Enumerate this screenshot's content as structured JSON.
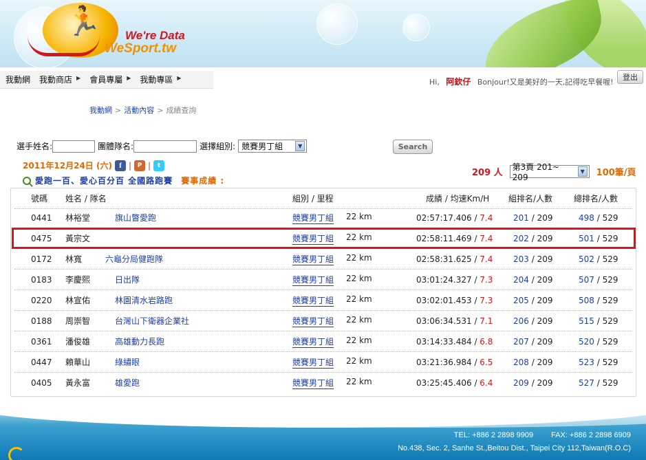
{
  "brand": {
    "line1": "We're Data",
    "line2": "WeSport.tw"
  },
  "nav": {
    "items": [
      {
        "label": "我動網",
        "has_arrow": false
      },
      {
        "label": "我動商店",
        "has_arrow": true
      },
      {
        "label": "會員專屬",
        "has_arrow": true
      },
      {
        "label": "我動專區",
        "has_arrow": true
      }
    ],
    "arrow_glyph": "▶"
  },
  "user": {
    "hi": "Hi,",
    "name": "阿欽仔",
    "message": "Bonjour!又是美好的一天,記得吃早餐喔!",
    "logout_label": "登出"
  },
  "breadcrumb": {
    "items": [
      "我動網",
      "活動內容",
      "成績查詢"
    ],
    "separator": ">"
  },
  "search": {
    "name_label": "選手姓名:",
    "team_label": "團體隊名:",
    "group_label": "選擇組別:",
    "group_selected": "競賽男丁組",
    "button_label": "Search"
  },
  "event": {
    "date": "2011年12月24日 (六)",
    "title": "愛跑一百、愛心百分百 全國路跑賽",
    "results_label": "賽事成績 :",
    "social_bar": "|"
  },
  "pager": {
    "total": "209 人",
    "page_selected": "第3頁 201~ 209",
    "per_page": "100筆/頁"
  },
  "table": {
    "headers": {
      "no": "號碼",
      "name": "姓名 / 隊名",
      "group": "組別 / 里程",
      "time": "成績 / 均速Km/H",
      "group_rank": "組排名/人數",
      "overall_rank": "總排名/人數"
    },
    "rows": [
      {
        "no": "0441",
        "name": "林裕堂",
        "team": "旗山瞥愛跑",
        "group": "競賽男丁組",
        "dist": "22 km",
        "time": "02:57:17.406",
        "pace": "7.4",
        "grank": "201",
        "gtotal": "209",
        "orank": "498",
        "ototal": "529"
      },
      {
        "no": "0475",
        "name": "黃宗文",
        "team": "",
        "group": "競賽男丁組",
        "dist": "22 km",
        "time": "02:58:11.469",
        "pace": "7.4",
        "grank": "202",
        "gtotal": "209",
        "orank": "501",
        "ototal": "529"
      },
      {
        "no": "0172",
        "name": "林寬",
        "team": "六龜分局健跑隊",
        "group": "競賽男丁組",
        "dist": "22 km",
        "time": "02:58:31.625",
        "pace": "7.4",
        "grank": "203",
        "gtotal": "209",
        "orank": "502",
        "ototal": "529"
      },
      {
        "no": "0183",
        "name": "李慶熙",
        "team": "日出隊",
        "group": "競賽男丁組",
        "dist": "22 km",
        "time": "03:01:24.327",
        "pace": "7.3",
        "grank": "204",
        "gtotal": "209",
        "orank": "507",
        "ototal": "529"
      },
      {
        "no": "0220",
        "name": "林宣佑",
        "team": "林園清水岩路跑",
        "group": "競賽男丁組",
        "dist": "22 km",
        "time": "03:02:01.453",
        "pace": "7.3",
        "grank": "205",
        "gtotal": "209",
        "orank": "508",
        "ototal": "529"
      },
      {
        "no": "0188",
        "name": "周崇智",
        "team": "台灣山下衛器企業社",
        "group": "競賽男丁組",
        "dist": "22 km",
        "time": "03:06:34.531",
        "pace": "7.1",
        "grank": "206",
        "gtotal": "209",
        "orank": "515",
        "ototal": "529"
      },
      {
        "no": "0361",
        "name": "潘俊雄",
        "team": "高雄動力長跑",
        "group": "競賽男丁組",
        "dist": "22 km",
        "time": "03:14:33.484",
        "pace": "6.8",
        "grank": "207",
        "gtotal": "209",
        "orank": "520",
        "ototal": "529"
      },
      {
        "no": "0447",
        "name": "賴華山",
        "team": "綠繡眼",
        "group": "競賽男丁組",
        "dist": "22 km",
        "time": "03:21:36.984",
        "pace": "6.5",
        "grank": "208",
        "gtotal": "209",
        "orank": "523",
        "ototal": "529"
      },
      {
        "no": "0405",
        "name": "黃永富",
        "team": "雄愛跑",
        "group": "競賽男丁組",
        "dist": "22 km",
        "time": "03:25:45.406",
        "pace": "6.4",
        "grank": "209",
        "gtotal": "209",
        "orank": "527",
        "ototal": "529"
      }
    ],
    "highlighted_row_no": "0475"
  },
  "footer": {
    "tel": "TEL: +886 2 2898 9909",
    "fax": "FAX: +886 2 2898 6909",
    "address": "No.438, Sec. 2, Sanhe St.,Beitou Dist., Taipei City 112,Taiwan(R.O.C)"
  },
  "colors": {
    "accent_red": "#d4161f",
    "link_blue": "#1d3fa8",
    "orange": "#e06a00",
    "highlight_border": "#e0101a"
  }
}
